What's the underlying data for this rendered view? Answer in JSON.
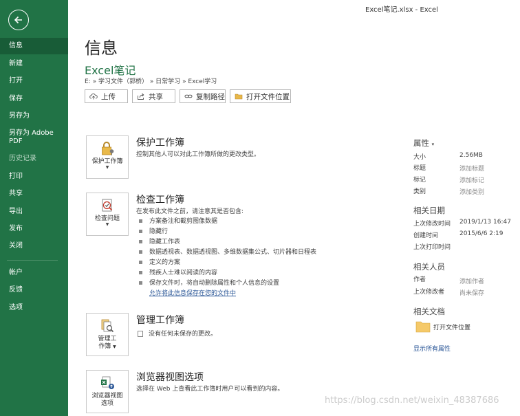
{
  "window_title": "Excel笔记.xlsx  -  Excel",
  "sidebar": {
    "items": [
      {
        "label": "信息"
      },
      {
        "label": "新建"
      },
      {
        "label": "打开"
      },
      {
        "label": "保存"
      },
      {
        "label": "另存为"
      },
      {
        "label": "另存为 Adobe PDF"
      },
      {
        "label": "历史记录"
      },
      {
        "label": "打印"
      },
      {
        "label": "共享"
      },
      {
        "label": "导出"
      },
      {
        "label": "发布"
      },
      {
        "label": "关闭"
      },
      {
        "label": "帐户"
      },
      {
        "label": "反馈"
      },
      {
        "label": "选项"
      }
    ]
  },
  "main": {
    "page_title": "信息",
    "file_title": "Excel笔记",
    "breadcrumb": "E: » 学习文件（郭桥）  » 日常学习 » Excel学习",
    "buttons": {
      "upload": "上传",
      "share": "共享",
      "copy_path": "复制路径",
      "open_location": "打开文件位置"
    },
    "protect": {
      "button": "保护工作簿",
      "title": "保护工作簿",
      "desc": "控制其他人可以对此工作簿所做的更改类型。"
    },
    "inspect": {
      "button": "检查问题",
      "title": "检查工作簿",
      "desc": "在发布此文件之前，请注意其是否包含:",
      "bullets": [
        "方案备注和截剪图像数据",
        "隐藏行",
        "隐藏工作表",
        "数据透视表、数据透视图、多维数据集公式、切片器和日程表",
        "定义的方案",
        "残疾人士难以阅读的内容",
        "保存文件时，将自动删除属性和个人信息的设置"
      ],
      "link": "允许将此信息保存在您的文件中"
    },
    "manage": {
      "button_line1": "管理工",
      "button_line2": "作簿",
      "title": "管理工作簿",
      "desc": "没有任何未保存的更改。"
    },
    "browser": {
      "button_line1": "浏览器视图",
      "button_line2": "选项",
      "title": "浏览器视图选项",
      "desc": "选择在 Web 上查看此工作簿时用户可以看到的内容。"
    }
  },
  "properties": {
    "heading": "属性",
    "size_label": "大小",
    "size_value": "2.56MB",
    "title_label": "标题",
    "title_value": "添加标题",
    "tag_label": "标记",
    "tag_value": "添加标记",
    "category_label": "类别",
    "category_value": "添加类别",
    "dates_heading": "相关日期",
    "modified_label": "上次修改时间",
    "modified_value": "2019/1/13 16:47",
    "created_label": "创建时间",
    "created_value": "2015/6/6 2:19",
    "printed_label": "上次打印时间",
    "people_heading": "相关人员",
    "author_label": "作者",
    "author_value": "添加作者",
    "modifier_label": "上次修改者",
    "modifier_value": "尚未保存",
    "docs_heading": "相关文档",
    "open_location": "打开文件位置",
    "show_all": "显示所有属性"
  },
  "watermark": "https://blog.csdn.net/weixin_48387686",
  "colors": {
    "sidebar_bg": "#217346",
    "sidebar_active": "#185c37",
    "accent": "#217346",
    "link": "#2b5797"
  }
}
